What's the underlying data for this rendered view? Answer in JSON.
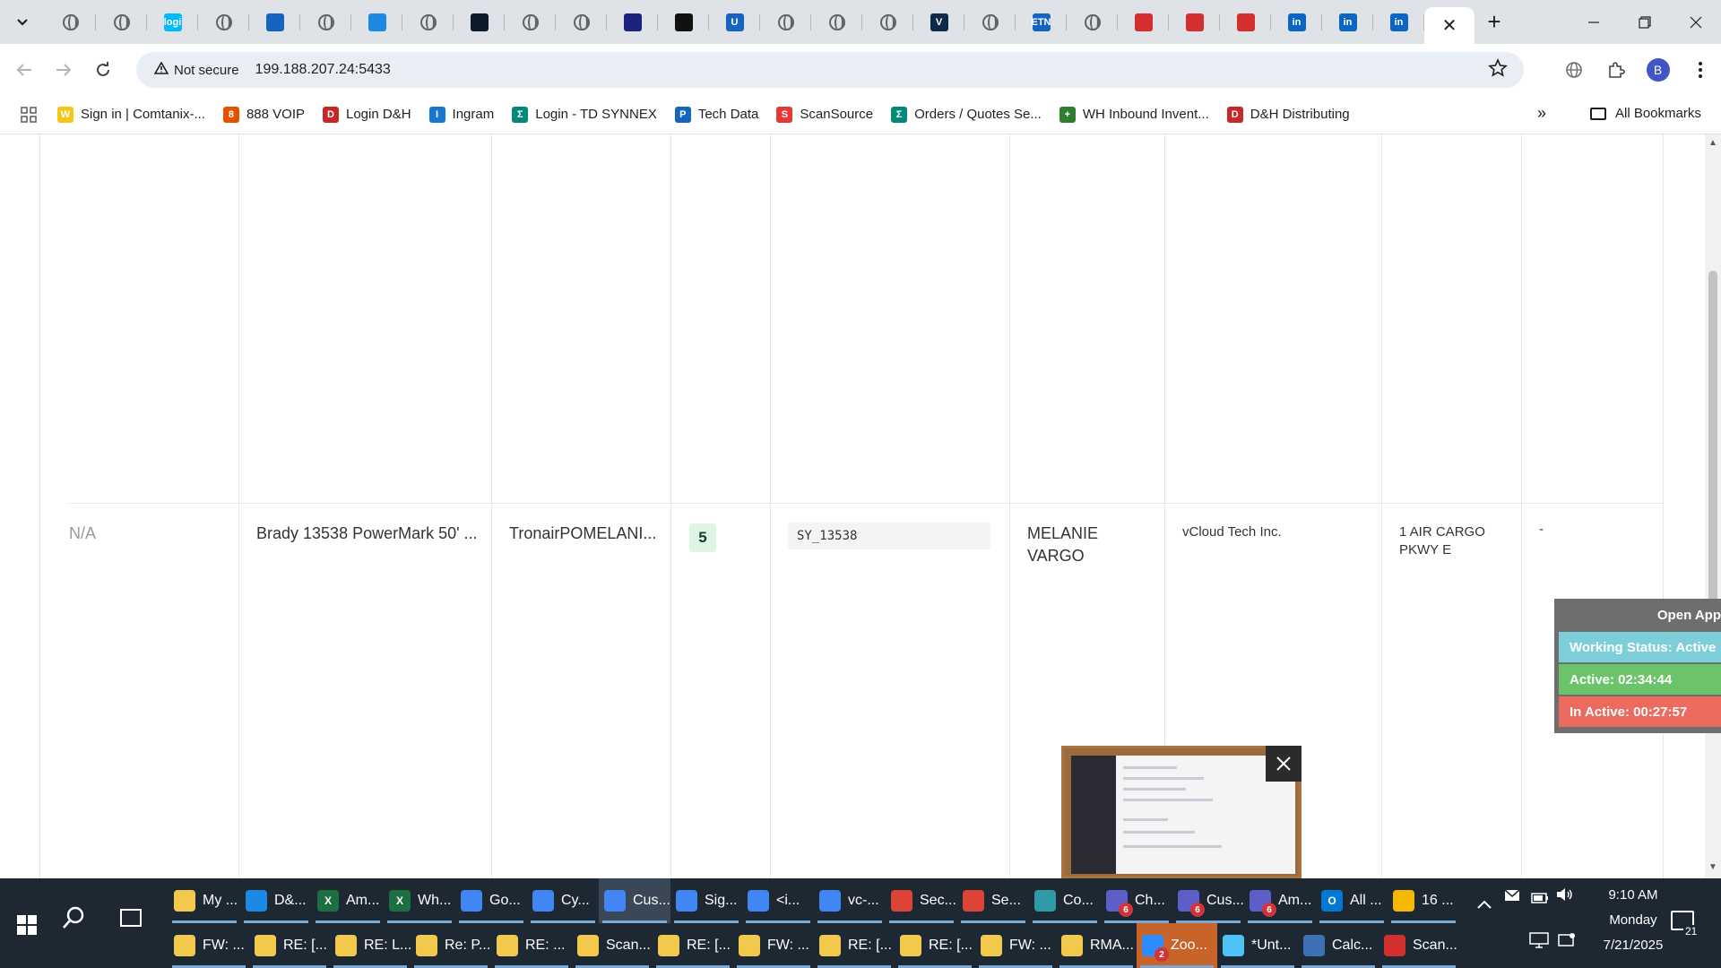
{
  "browser": {
    "tab_close_glyph": "✕",
    "new_tab_glyph": "+",
    "tab_favicons": [
      {
        "name": "globe",
        "color": "#5f6368"
      },
      {
        "name": "globe",
        "color": "#5f6368"
      },
      {
        "name": "logi",
        "color": "#00b8fc",
        "text": "logi"
      },
      {
        "name": "globe",
        "color": "#5f6368"
      },
      {
        "name": "chevron-arrow",
        "color": "#1565c0"
      },
      {
        "name": "globe",
        "color": "#5f6368"
      },
      {
        "name": "cloud-app",
        "color": "#1e88e5"
      },
      {
        "name": "globe",
        "color": "#5f6368"
      },
      {
        "name": "dark-circle",
        "color": "#0d1b2a"
      },
      {
        "name": "globe",
        "color": "#5f6368"
      },
      {
        "name": "globe",
        "color": "#5f6368"
      },
      {
        "name": "tortoise",
        "color": "#1a237e"
      },
      {
        "name": "triangle-a",
        "color": "#111111"
      },
      {
        "name": "u-logo",
        "color": "#1565c0",
        "text": "U"
      },
      {
        "name": "globe",
        "color": "#5f6368"
      },
      {
        "name": "globe",
        "color": "#5f6368"
      },
      {
        "name": "globe",
        "color": "#5f6368"
      },
      {
        "name": "checkmark-v",
        "color": "#0d2a4a",
        "text": "V"
      },
      {
        "name": "globe",
        "color": "#5f6368"
      },
      {
        "name": "etn",
        "color": "#1565c0",
        "text": "ETN"
      },
      {
        "name": "globe",
        "color": "#5f6368"
      },
      {
        "name": "shield-red",
        "color": "#d32f2f"
      },
      {
        "name": "shield-red",
        "color": "#d32f2f"
      },
      {
        "name": "shield-red",
        "color": "#d32f2f"
      },
      {
        "name": "linkedin",
        "color": "#0a66c2",
        "text": "in"
      },
      {
        "name": "linkedin",
        "color": "#0a66c2",
        "text": "in"
      },
      {
        "name": "linkedin",
        "color": "#0a66c2",
        "text": "in"
      }
    ],
    "security_label": "Not secure",
    "url": "199.188.207.24:5433",
    "profile_initial": "B",
    "bookmarks": [
      {
        "label": "Sign in | Comtanix-...",
        "color": "#f5c518",
        "text": "W"
      },
      {
        "label": "888 VOIP",
        "color": "#e65100",
        "text": "8"
      },
      {
        "label": "Login D&H",
        "color": "#c62828",
        "text": "D"
      },
      {
        "label": "Ingram",
        "color": "#1976d2",
        "text": "I"
      },
      {
        "label": "Login - TD SYNNEX",
        "color": "#00897b",
        "text": "Σ"
      },
      {
        "label": "Tech Data",
        "color": "#1565c0",
        "text": "P"
      },
      {
        "label": "ScanSource",
        "color": "#e53935",
        "text": "S"
      },
      {
        "label": "Orders / Quotes Se...",
        "color": "#00897b",
        "text": "Σ"
      },
      {
        "label": "WH Inbound Invent...",
        "color": "#2e7d32",
        "text": "+"
      },
      {
        "label": "D&H Distributing",
        "color": "#c62828",
        "text": "D"
      }
    ],
    "bookmarks_more": "»",
    "all_bookmarks": "All Bookmarks"
  },
  "table_row": {
    "col1": "N/A",
    "product": "Brady 13538 PowerMark 50' ...",
    "customer": "TronairPOMELANI...",
    "quantity": "5",
    "sku": "SY_13538",
    "contact_line1": "MELANIE",
    "contact_line2": "VARGO",
    "vendor": "vCloud Tech Inc.",
    "address_line1": "1 AIR CARGO",
    "address_line2": "PKWY E",
    "extra": "-"
  },
  "status_widget": {
    "open_app": "Open App",
    "working_status": "Working Status: Active",
    "active": "Active: 02:34:44",
    "inactive": "In Active: 00:27:57",
    "colors": {
      "status": "#7ccfd8",
      "active": "#6cc46a",
      "inactive": "#ec6b5e"
    }
  },
  "taskbar": {
    "top_row": [
      {
        "label": "My ...",
        "icon": "folder-icon",
        "color": "#f2c94c"
      },
      {
        "label": "D&...",
        "icon": "edge-icon",
        "color": "#1e88e5"
      },
      {
        "label": "Am...",
        "icon": "excel-icon",
        "color": "#1d6f42",
        "text": "X"
      },
      {
        "label": "Wh...",
        "icon": "excel-icon",
        "color": "#1d6f42",
        "text": "X"
      },
      {
        "label": "Go...",
        "icon": "chrome-icon",
        "color": "#4285f4"
      },
      {
        "label": "Cy...",
        "icon": "chrome-icon",
        "color": "#4285f4"
      },
      {
        "label": "Cus...",
        "icon": "chrome-icon",
        "color": "#4285f4",
        "current": true
      },
      {
        "label": "Sig...",
        "icon": "chrome-icon",
        "color": "#4285f4"
      },
      {
        "label": "<i...",
        "icon": "chrome-icon",
        "color": "#4285f4"
      },
      {
        "label": "vc-...",
        "icon": "chrome-icon",
        "color": "#4285f4"
      },
      {
        "label": "Sec...",
        "icon": "chrome-icon",
        "color": "#db4437"
      },
      {
        "label": "Se...",
        "icon": "chrome-icon",
        "color": "#db4437"
      },
      {
        "label": "Co...",
        "icon": "copilot-icon",
        "color": "#2f9aa8"
      },
      {
        "label": "Ch...",
        "icon": "teams-icon",
        "color": "#5b5fc7",
        "badge": "6"
      },
      {
        "label": "Cus...",
        "icon": "teams-icon",
        "color": "#5b5fc7",
        "badge": "6"
      },
      {
        "label": "Am...",
        "icon": "teams-icon",
        "color": "#5b5fc7",
        "badge": "6"
      },
      {
        "label": "All ...",
        "icon": "outlook-icon",
        "color": "#0078d4",
        "text": "O"
      },
      {
        "label": "16 ...",
        "icon": "bell-icon",
        "color": "#f5b800"
      }
    ],
    "bottom_row": [
      {
        "label": "FW: ...",
        "icon": "mail-icon",
        "color": "#f2c94c"
      },
      {
        "label": "RE: [...",
        "icon": "mail-icon",
        "color": "#f2c94c"
      },
      {
        "label": "RE: L...",
        "icon": "mail-icon",
        "color": "#f2c94c"
      },
      {
        "label": "Re: P...",
        "icon": "mail-icon",
        "color": "#f2c94c"
      },
      {
        "label": "RE: ...",
        "icon": "mail-icon",
        "color": "#f2c94c"
      },
      {
        "label": "Scan...",
        "icon": "mail-icon",
        "color": "#f2c94c"
      },
      {
        "label": "RE: [...",
        "icon": "mail-icon",
        "color": "#f2c94c"
      },
      {
        "label": "FW: ...",
        "icon": "mail-icon",
        "color": "#f2c94c"
      },
      {
        "label": "RE: [...",
        "icon": "mail-icon",
        "color": "#f2c94c"
      },
      {
        "label": "RE: [...",
        "icon": "mail-icon",
        "color": "#f2c94c"
      },
      {
        "label": "FW: ...",
        "icon": "mail-icon",
        "color": "#f2c94c"
      },
      {
        "label": "RMA...",
        "icon": "mail-icon",
        "color": "#f2c94c"
      },
      {
        "label": "Zoo...",
        "icon": "zoom-icon",
        "color": "#2d8cff",
        "badge": "2",
        "highlight": true
      },
      {
        "label": "*Unt...",
        "icon": "notepad-icon",
        "color": "#4fc3f7"
      },
      {
        "label": "Calc...",
        "icon": "calculator-icon",
        "color": "#3f6fb5"
      },
      {
        "label": "Scan...",
        "icon": "pdf-icon",
        "color": "#d32f2f"
      }
    ],
    "clock_time": "9:10 AM",
    "clock_day": "Monday",
    "clock_date": "7/21/2025",
    "notification_count": "21"
  }
}
